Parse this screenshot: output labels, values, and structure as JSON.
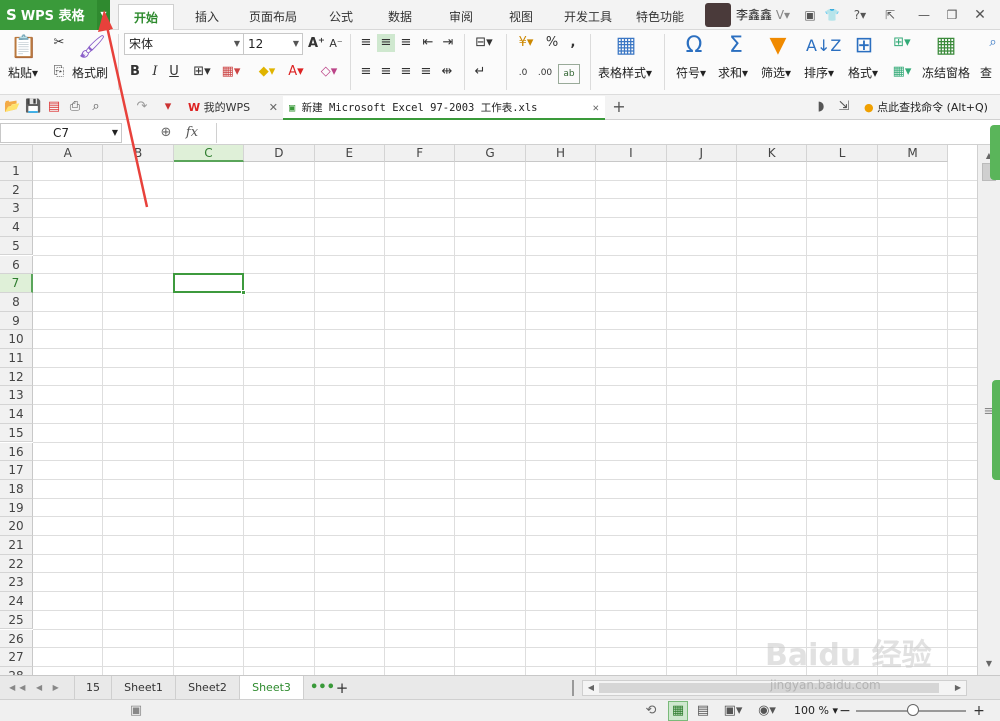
{
  "app": {
    "name": "WPS 表格",
    "logo": "S"
  },
  "menu_tabs": [
    "开始",
    "插入",
    "页面布局",
    "公式",
    "数据",
    "审阅",
    "视图",
    "开发工具",
    "特色功能"
  ],
  "active_tab": "开始",
  "user": {
    "name": "李鑫鑫"
  },
  "ribbon": {
    "paste": "粘贴",
    "format_painter": "格式刷",
    "font_name": "宋体",
    "font_size": "12",
    "bold": "B",
    "italic": "I",
    "underline": "U",
    "table_style": "表格样式",
    "symbol": "符号",
    "sum": "求和",
    "filter": "筛选",
    "sort": "排序",
    "format": "格式",
    "freeze": "冻结窗格",
    "find": "查",
    "percent": "%",
    "comma": ","
  },
  "doc_tabs": [
    {
      "label": "我的WPS"
    },
    {
      "label": "新建 Microsoft Excel 97-2003 工作表.xls"
    }
  ],
  "command_search": "点此查找命令 (Alt+Q)",
  "formula_bar": {
    "name_box": "C7",
    "fx": "fx",
    "value": ""
  },
  "columns": [
    "A",
    "B",
    "C",
    "D",
    "E",
    "F",
    "G",
    "H",
    "I",
    "J",
    "K",
    "L",
    "M"
  ],
  "rows": [
    "1",
    "2",
    "3",
    "4",
    "5",
    "6",
    "7",
    "8",
    "9",
    "10",
    "11",
    "12",
    "13",
    "14",
    "15",
    "16",
    "17",
    "18",
    "19",
    "20",
    "21",
    "22",
    "23",
    "24",
    "25",
    "26",
    "27",
    "28"
  ],
  "selected": {
    "column": "C",
    "row": "7"
  },
  "sheets": [
    "15",
    "Sheet1",
    "Sheet2",
    "Sheet3"
  ],
  "active_sheet": "Sheet3",
  "status": {
    "zoom": "100 %",
    "zoom_level": 0.52
  },
  "watermark": {
    "text": "Baidu 经验",
    "url": "jingyan.baidu.com"
  },
  "colors": {
    "accent": "#3a9a3a",
    "annotation": "#e8413b"
  }
}
